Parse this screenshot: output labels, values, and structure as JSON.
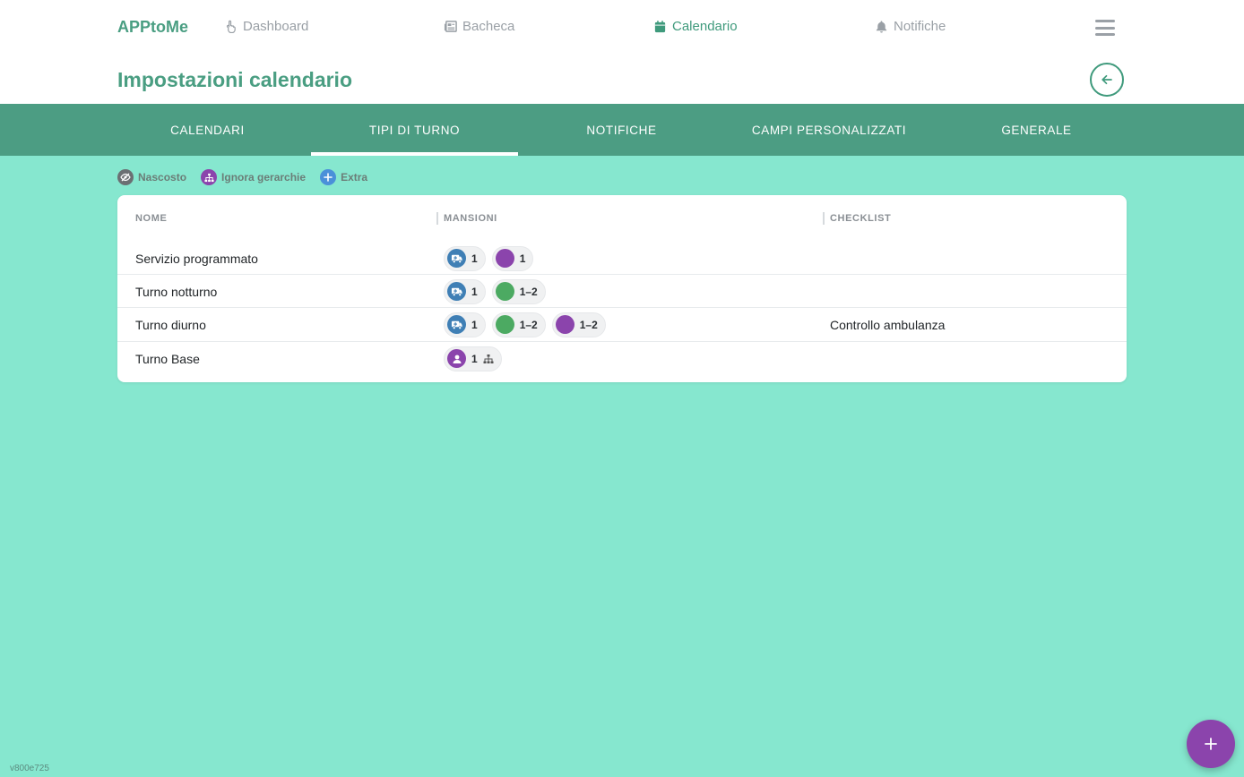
{
  "header": {
    "brand": "APPtoMe",
    "nav": [
      {
        "label": "Dashboard",
        "icon": "hand-pointer-icon",
        "active": false
      },
      {
        "label": "Bacheca",
        "icon": "newspaper-icon",
        "active": false
      },
      {
        "label": "Calendario",
        "icon": "calendar-icon",
        "active": true
      },
      {
        "label": "Notifiche",
        "icon": "bell-icon",
        "active": false
      }
    ],
    "page_title": "Impostazioni calendario"
  },
  "tabs": [
    {
      "label": "CALENDARI",
      "active": false
    },
    {
      "label": "TIPI DI TURNO",
      "active": true
    },
    {
      "label": "NOTIFICHE",
      "active": false
    },
    {
      "label": "CAMPI PERSONALIZZATI",
      "active": false
    },
    {
      "label": "GENERALE",
      "active": false
    }
  ],
  "legend": [
    {
      "label": "Nascosto",
      "icon": "eye-slash-icon",
      "color": "#6b6f73"
    },
    {
      "label": "Ignora gerarchie",
      "icon": "sitemap-icon",
      "color": "#8b44ac"
    },
    {
      "label": "Extra",
      "icon": "plus-icon",
      "color": "#4a90d9"
    }
  ],
  "table": {
    "columns": [
      "NOME",
      "MANSIONI",
      "CHECKLIST"
    ],
    "rows": [
      {
        "name": "Servizio programmato",
        "checklist": "",
        "mansioni": [
          {
            "icon": "ambulance-icon",
            "color": "#3f7fb5",
            "count": "1"
          },
          {
            "icon": "dot-icon",
            "color": "#8b44ac",
            "count": "1"
          }
        ]
      },
      {
        "name": "Turno notturno",
        "checklist": "",
        "mansioni": [
          {
            "icon": "ambulance-icon",
            "color": "#3f7fb5",
            "count": "1"
          },
          {
            "icon": "dot-icon",
            "color": "#4caa62",
            "count": "1–2"
          }
        ]
      },
      {
        "name": "Turno diurno",
        "checklist": "Controllo ambulanza",
        "mansioni": [
          {
            "icon": "ambulance-icon",
            "color": "#3f7fb5",
            "count": "1"
          },
          {
            "icon": "dot-icon",
            "color": "#4caa62",
            "count": "1–2"
          },
          {
            "icon": "dot-icon",
            "color": "#8b44ac",
            "count": "1–2"
          }
        ]
      },
      {
        "name": "Turno Base",
        "checklist": "",
        "mansioni": [
          {
            "icon": "user-icon",
            "color": "#8b44ac",
            "count": "1",
            "ignore_hierarchy": true
          }
        ]
      }
    ]
  },
  "version": "v800e725",
  "colors": {
    "accent": "#4a9e82",
    "tabbar": "#4c9d83",
    "background": "#86e7cf",
    "fab": "#8b44ac"
  }
}
